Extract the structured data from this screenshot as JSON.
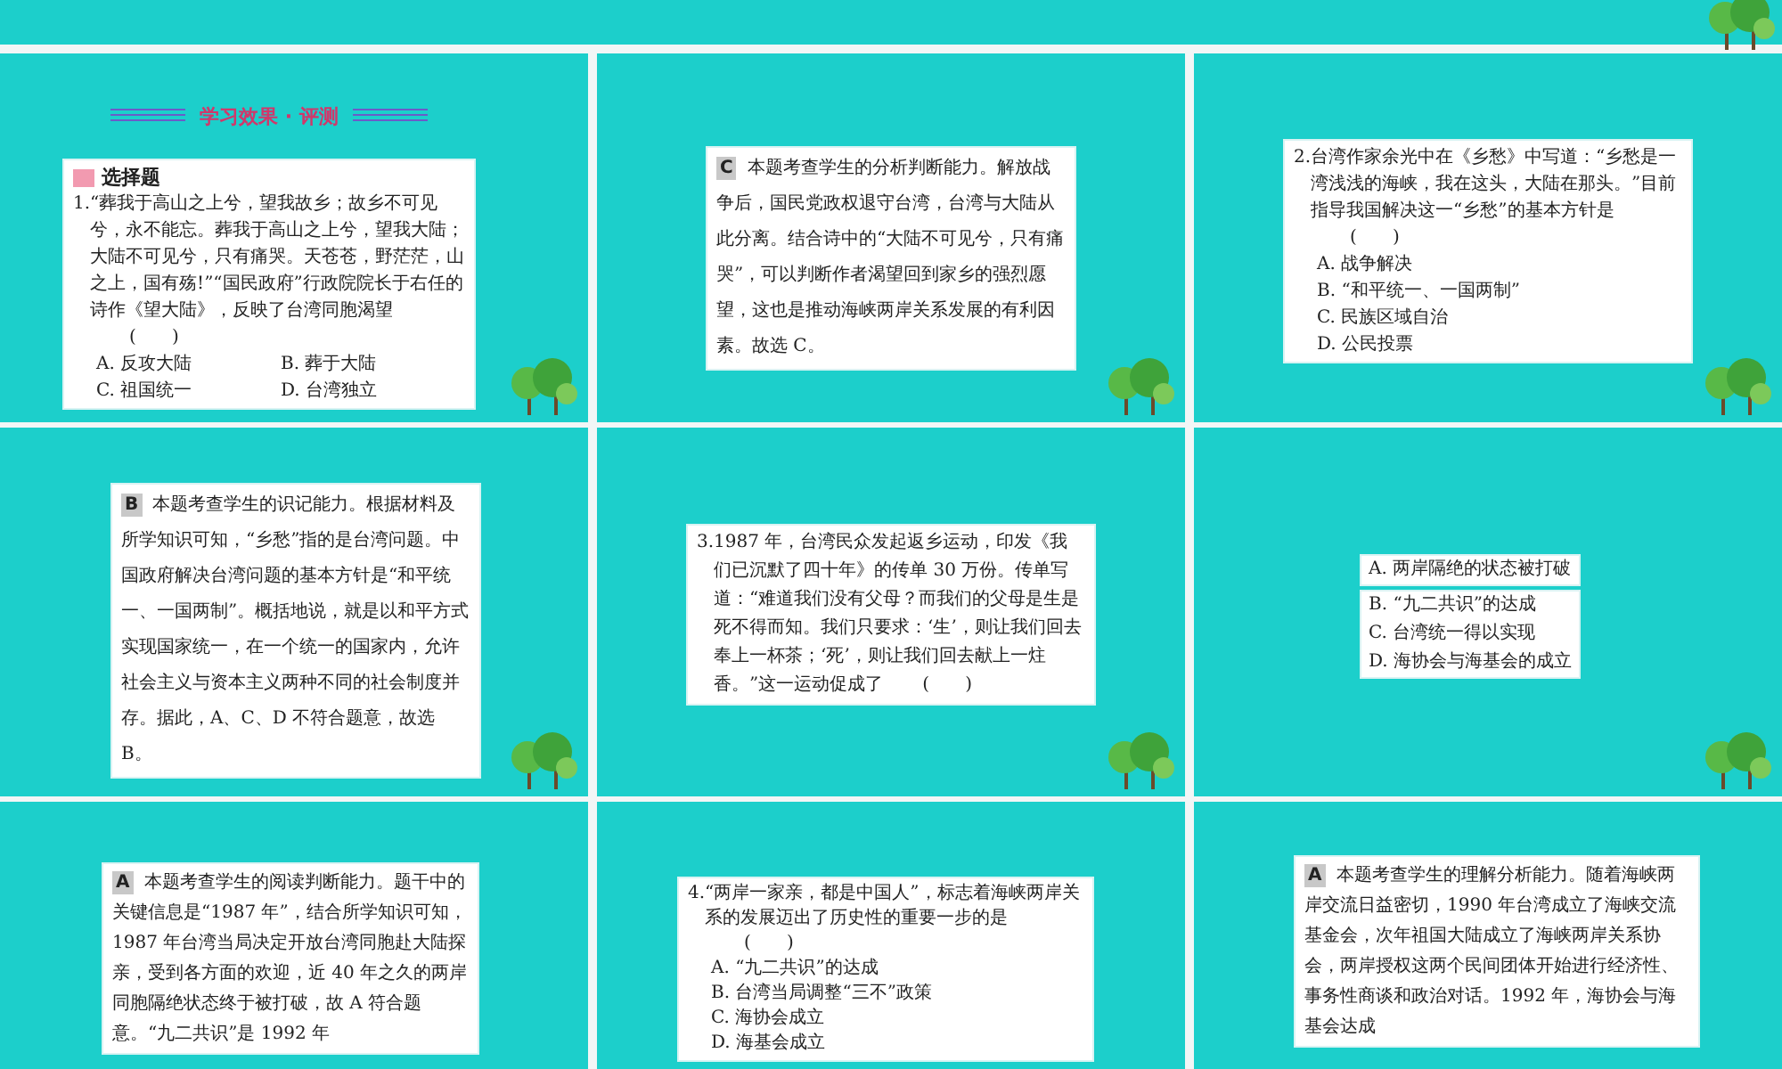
{
  "slides": [
    {
      "kind": "question_grid",
      "section_title": "学习效果 · 评测",
      "category": "选择题",
      "number": "1.",
      "stem": "“葬我于高山之上兮，望我故乡；故乡不可见兮，永不能忘。葬我于高山之上兮，望我大陆；大陆不可见兮，只有痛哭。天苍苍，野茫茫，山之上，国有殇!”“国民政府”行政院院长于右任的诗作《望大陆》，反映了台湾同胞渴望",
      "blank": "(　　)",
      "options": [
        "A. 反攻大陆",
        "B. 葬于大陆",
        "C. 祖国统一",
        "D. 台湾独立"
      ]
    },
    {
      "kind": "answer",
      "letter": "C",
      "text": "本题考查学生的分析判断能力。解放战争后，国民党政权退守台湾，台湾与大陆从此分离。结合诗中的“大陆不可见兮，只有痛哭”，可以判断作者渴望回到家乡的强烈愿望，这也是推动海峡两岸关系发展的有利因素。故选 C。"
    },
    {
      "kind": "question",
      "number": "2.",
      "stem": "台湾作家余光中在《乡愁》中写道：“乡愁是一湾浅浅的海峡，我在这头，大陆在那头。”目前指导我国解决这一“乡愁”的基本方针是",
      "blank": "(　　)",
      "options": [
        "A. 战争解决",
        "B. “和平统一、一国两制”",
        "C. 民族区域自治",
        "D. 公民投票"
      ]
    },
    {
      "kind": "answer",
      "letter": "B",
      "text": "本题考查学生的识记能力。根据材料及所学知识可知，“乡愁”指的是台湾问题。中国政府解决台湾问题的基本方针是“和平统一、一国两制”。概括地说，就是以和平方式实现国家统一，在一个统一的国家内，允许社会主义与资本主义两种不同的社会制度并存。据此，A、C、D 不符合题意，故选 B。"
    },
    {
      "kind": "question",
      "number": "3.",
      "stem": "1987 年，台湾民众发起返乡运动，印发《我们已沉默了四十年》的传单 30 万份。传单写道：“难道我们没有父母？而我们的父母是生是死不得而知。我们只要求：‘生’，则让我们回去奉上一杯茶；‘死’，则让我们回去献上一炷香。”这一运动促成了",
      "blank": "(　　)"
    },
    {
      "kind": "options",
      "lead_option": "A. 两岸隔绝的状态被打破",
      "options": [
        "B. “九二共识”的达成",
        "C. 台湾统一得以实现",
        "D. 海协会与海基会的成立"
      ]
    },
    {
      "kind": "answer",
      "letter": "A",
      "text": "本题考查学生的阅读判断能力。题干中的关键信息是“1987 年”，结合所学知识可知，1987 年台湾当局决定开放台湾同胞赴大陆探亲，受到各方面的欢迎，近 40 年之久的两岸同胞隔绝状态终于被打破，故 A 符合题意。“九二共识”是 1992 年"
    },
    {
      "kind": "question",
      "number": "4.",
      "stem": "“两岸一家亲，都是中国人”，标志着海峡两岸关系的发展迈出了历史性的重要一步的是",
      "blank": "(　　)",
      "options": [
        "A. “九二共识”的达成",
        "B. 台湾当局调整“三不”政策",
        "C. 海协会成立",
        "D. 海基会成立"
      ]
    },
    {
      "kind": "answer",
      "letter": "A",
      "text": "本题考查学生的理解分析能力。随着海峡两岸交流日益密切，1990 年台湾成立了海峡交流基金会，次年祖国大陆成立了海峡两岸关系协会，两岸授权这两个民间团体开始进行经济性、事务性商谈和政治对话。1992 年，海协会与海基会达成"
    }
  ]
}
